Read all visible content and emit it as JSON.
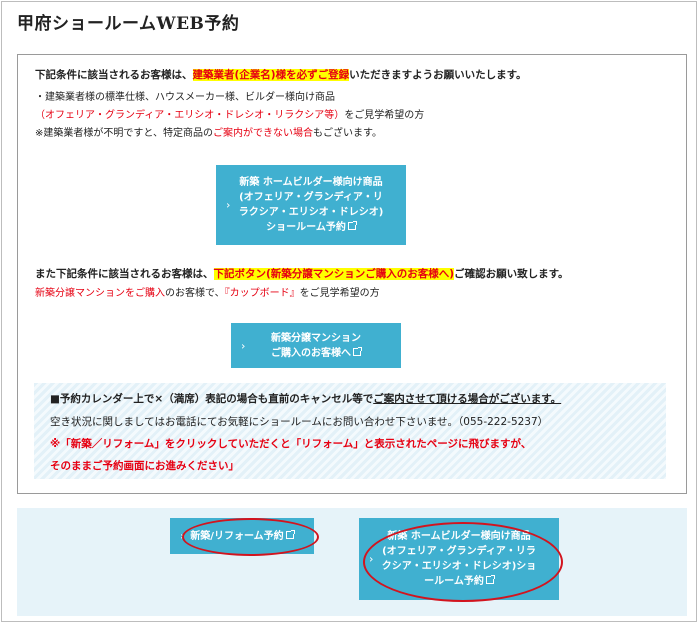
{
  "title": "甲府ショールームWEB予約",
  "section1": {
    "intro_pre": "下記条件に該当されるお客様は、",
    "intro_highlight": "建築業者(企業名)様を必ずご登録",
    "intro_post": "いただきますようお願いいたします。",
    "bullet": "・建築業者様の標準仕様、ハウスメーカー様、ビルダー様向け商品",
    "products": "（オフェリア・グランディア・エリシオ・ドレシオ・リラクシア等）",
    "products_post": "をご見学希望の方",
    "note_pre": "※建築業者様が不明ですと、特定商品の",
    "note_red": "ご案内ができない場合",
    "note_post": "もございます。"
  },
  "builder_button": {
    "line1": "新築 ホームビルダー様向け商品",
    "line2": "(オフェリア・グランディア・リ",
    "line3": "ラクシア・エリシオ・ドレシオ)",
    "line4": "ショールーム予約"
  },
  "section2": {
    "intro_pre": "また下記条件に該当されるお客様は、",
    "intro_highlight": "下記ボタン(新築分譲マンションご購入のお客様へ)",
    "intro_post": "ご確認お願い致します。",
    "sub_red1": "新築分譲マンションをご購入",
    "sub_mid": "のお客様で、",
    "sub_red2": "『カップボード』",
    "sub_post": "をご見学希望の方"
  },
  "condo_button": {
    "line1": "新築分譲マンション",
    "line2": "ご購入のお客様へ"
  },
  "notice": {
    "line1_pre": "■予約カレンダー上で×（満席）表記の場合も直前のキャンセル等で",
    "line1_u": "ご案内させて頂ける場合がございます。",
    "line2": "空き状況に関しましてはお電話にてお気軽にショールームにお問い合わせ下さいませ。（055-222-5237）",
    "line3": "※「新築／リフォーム」をクリックしていただくと「リフォーム」と表示されたページに飛びますが、",
    "line4": "そのままご予約画面にお進みください」"
  },
  "bottom": {
    "reform_button": "新築/リフォーム予約",
    "builder_line1": "新築 ホームビルダー様向け商品",
    "builder_line2": "(オフェリア・グランディア・リラ",
    "builder_line3": "クシア・エリシオ・ドレシオ)ショ",
    "builder_line4": "ールーム予約"
  },
  "colors": {
    "button": "#40b0d0",
    "highlight": "#ffff00",
    "red": "#e60012",
    "panel": "#e6f3f9",
    "annotation": "#d2141e"
  }
}
